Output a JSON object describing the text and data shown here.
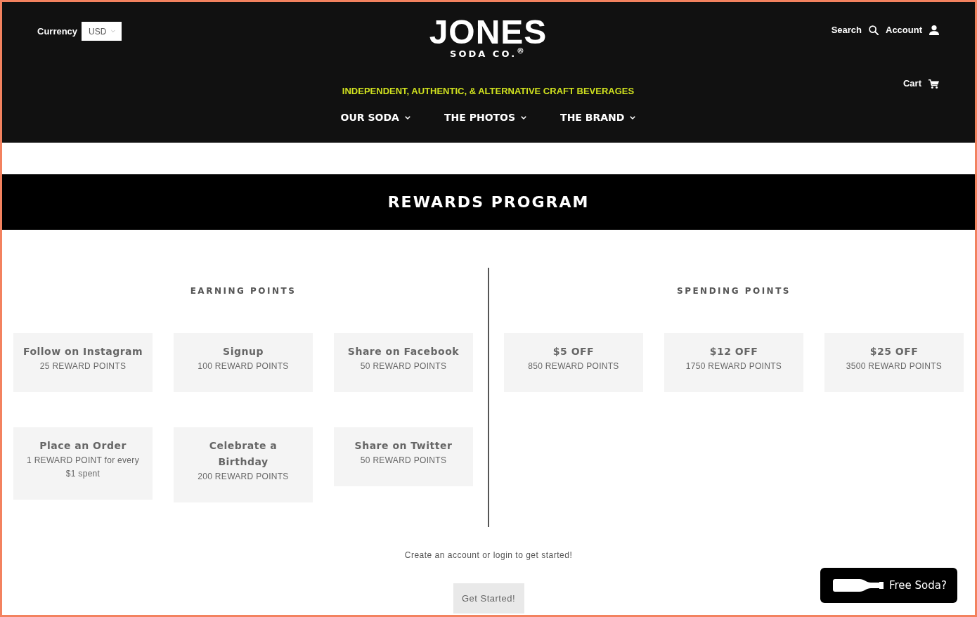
{
  "header": {
    "currency": {
      "label": "Currency",
      "value": "USD"
    },
    "logo": {
      "name": "JONES",
      "sub": "SODA CO.$^{®}$"
    },
    "tagline": "INDEPENDENT, AUTHENTIC, & ALTERNATIVE CRAFT BEVERAGES",
    "nav": [
      {
        "label": "OUR SODA"
      },
      {
        "label": "THE PHOTOS"
      },
      {
        "label": "THE BRAND"
      }
    ],
    "utility": [
      {
        "label": "Search",
        "kind": "search"
      },
      {
        "label": "Account",
        "kind": "account"
      }
    ],
    "cart": {
      "label": "Cart"
    }
  },
  "banner": {
    "title": "REWARDS PROGRAM"
  },
  "earning": {
    "title": "EARNING POINTS",
    "cards": [
      {
        "title": "Follow on Instagram",
        "points": "25 REWARD POINTS"
      },
      {
        "title": "Signup",
        "points": "100 REWARD POINTS"
      },
      {
        "title": "Share on Facebook",
        "points": "50 REWARD POINTS"
      },
      {
        "title": "Place an Order",
        "points": "1 REWARD POINT for every $1 spent"
      },
      {
        "title": "Celebrate a Birthday",
        "points": "200 REWARD POINTS"
      },
      {
        "title": "Share on Twitter",
        "points": "50 REWARD POINTS"
      }
    ]
  },
  "spending": {
    "title": "SPENDING POINTS",
    "cards": [
      {
        "title": "$5 OFF",
        "points": "850 REWARD POINTS"
      },
      {
        "title": "$12 OFF",
        "points": "1750 REWARD POINTS"
      },
      {
        "title": "$25 OFF",
        "points": "3500 REWARD POINTS"
      }
    ]
  },
  "cta": {
    "text": "Create an account or login to get started!",
    "button": "Get Started!"
  },
  "widget": {
    "label": "Free Soda?"
  }
}
